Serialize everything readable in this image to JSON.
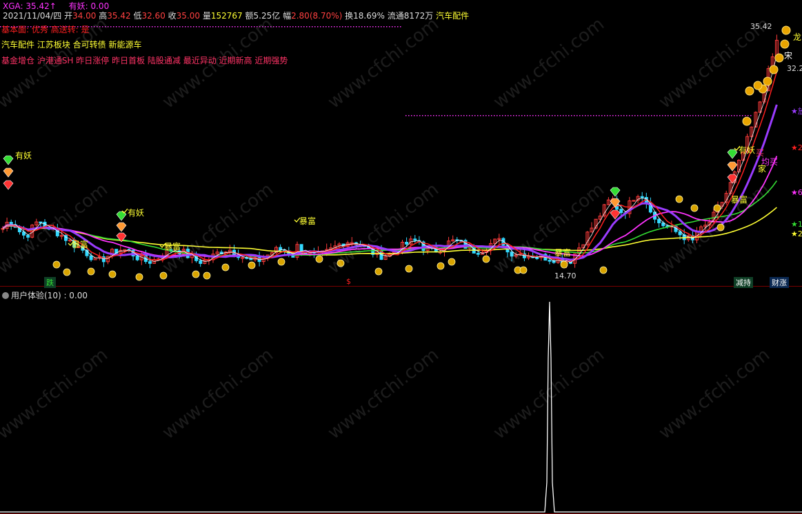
{
  "header": {
    "symbol": "XGA: 35.42",
    "symbol_arrow": "↑",
    "yaoprice": "有妖: 0.00",
    "date": "2021/11/04/四",
    "open_lbl": "开",
    "open": "34.00",
    "high_lbl": "高",
    "high": "35.42",
    "low_lbl": "低",
    "low": "32.60",
    "close_lbl": "收",
    "close": "35.00",
    "vol_lbl": "量",
    "vol": "152767",
    "amt": "额5.25亿",
    "chg_lbl": "幅",
    "chg": "2.80(8.70%)",
    "turnover": "换18.69%",
    "float": "流通8172万",
    "sector": "汽车配件"
  },
  "info": {
    "fundamentals": "基本面: 优秀    高送转: 是",
    "concepts": "汽车配件 江苏板块 合可转债 新能源车",
    "signals": "基金增仓 沪港通SH 昨日涨停 昨日首板 陆股通减 最近异动 近期新高 近期强势"
  },
  "price": {
    "high_mark": "35.42",
    "low_mark": "14.70",
    "right_partial": "32.2"
  },
  "labels": {
    "yao": "有妖",
    "baofu": "暴富",
    "die": "跌",
    "jianchi": "减持",
    "caizhang": "财涨",
    "long": "龙",
    "maimai": "买",
    "yimai": "均买",
    "jia": "家",
    "song": "宋",
    "dollar": "$"
  },
  "right_markers": [
    "★放",
    "★2",
    "★6",
    "★1",
    "★2"
  ],
  "indicator": {
    "title": "用户体验(10) : 0.00"
  },
  "watermark": "www.cfchi.com",
  "colors": {
    "bg": "#000000",
    "up": "#ff3b3b",
    "down": "#33d9ff",
    "yellow": "#ffff33",
    "magenta": "#ff33ff",
    "purple": "#9a3cff",
    "green": "#33dd33",
    "white": "#ffffff",
    "red": "#ff2020"
  }
}
